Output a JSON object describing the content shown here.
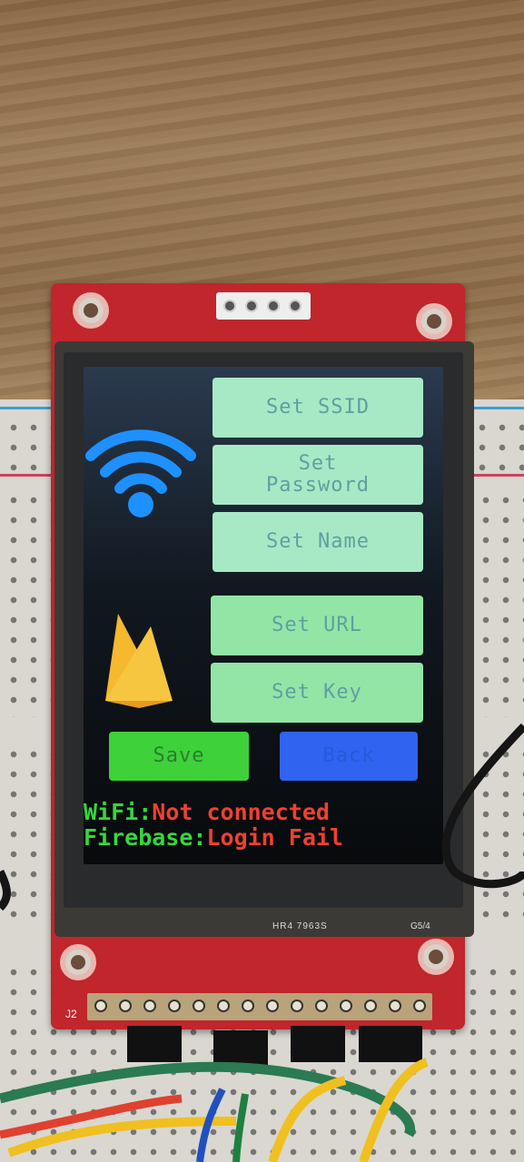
{
  "screen": {
    "menu_buttons": [
      {
        "label": "Set SSID"
      },
      {
        "label": "Set\nPassword"
      },
      {
        "label": "Set Name"
      },
      {
        "label": "Set URL"
      },
      {
        "label": "Set Key"
      }
    ],
    "save_label": "Save",
    "back_label": "Back",
    "wifi_label": "WiFi:",
    "wifi_status": "Not connected",
    "firebase_label": "Firebase:",
    "firebase_status": "Login Fail",
    "icons": [
      "wifi-icon",
      "firebase-icon"
    ]
  },
  "board": {
    "connector_label": "J2",
    "silkscreen_text": "HR4 7963S",
    "silkscreen_text_2": "G5/4"
  },
  "colors": {
    "menu_button": "#a7e9c4",
    "save_button": "#3ed13a",
    "back_button": "#2f63f0",
    "status_label": "#35d83a",
    "status_value": "#f04030",
    "wifi_icon": "#1e90ff",
    "firebase_icon": "#f5b82e"
  }
}
